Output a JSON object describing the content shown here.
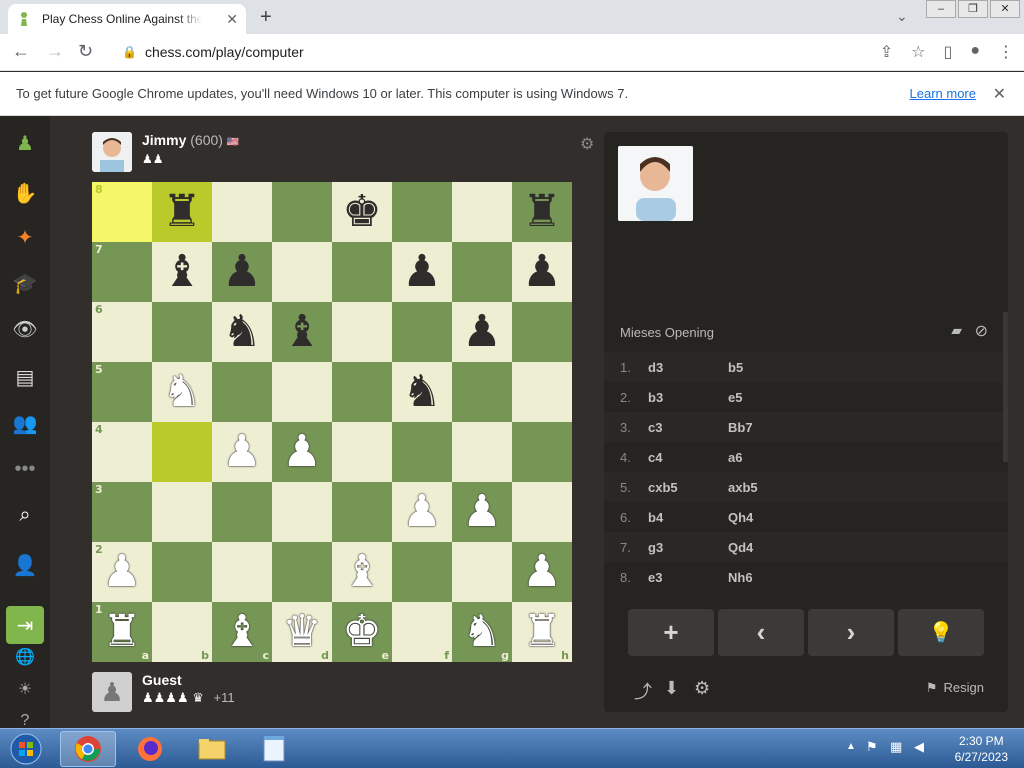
{
  "browser": {
    "tab_title": "Play Chess Online Against the Computer",
    "url": "chess.com/play/computer",
    "infobar_text": "To get future Google Chrome updates, you'll need Windows 10 or later. This computer is using Windows 7.",
    "infobar_link": "Learn more"
  },
  "top_player": {
    "name": "Jimmy",
    "rating": "(600)",
    "flag": "🇺🇸"
  },
  "bottom_player": {
    "name": "Guest",
    "captured": "♟♟♟♟ ♛",
    "material": "+11"
  },
  "board": {
    "ranks": [
      "8",
      "7",
      "6",
      "5",
      "4",
      "3",
      "2",
      "1"
    ],
    "files": [
      "a",
      "b",
      "c",
      "d",
      "e",
      "f",
      "g",
      "h"
    ],
    "rows": [
      [
        "",
        "bR",
        "",
        "",
        "bK",
        "",
        "",
        "bR"
      ],
      [
        "",
        "bB",
        "bP",
        "",
        "",
        "bP",
        "",
        "bP"
      ],
      [
        "",
        "",
        "bN",
        "bB",
        "",
        "",
        "bP",
        ""
      ],
      [
        "",
        "wN",
        "",
        "",
        "",
        "bN",
        "",
        ""
      ],
      [
        "",
        "",
        "wP",
        "wP",
        "",
        "",
        "",
        ""
      ],
      [
        "",
        "",
        "",
        "",
        "",
        "wP",
        "wP",
        ""
      ],
      [
        "wP",
        "",
        "",
        "",
        "wB",
        "",
        "",
        "wP"
      ],
      [
        "wR",
        "",
        "wB",
        "wQ",
        "wK",
        "",
        "wN",
        "wR"
      ]
    ],
    "highlighted": [
      "a8",
      "b8",
      "b4"
    ]
  },
  "opening": "Mieses Opening",
  "moves": [
    {
      "n": "1.",
      "w": "d3",
      "b": "b5"
    },
    {
      "n": "2.",
      "w": "b3",
      "b": "e5"
    },
    {
      "n": "3.",
      "w": "c3",
      "b": "Bb7"
    },
    {
      "n": "4.",
      "w": "c4",
      "b": "a6"
    },
    {
      "n": "5.",
      "w": "cxb5",
      "b": "axb5"
    },
    {
      "n": "6.",
      "w": "b4",
      "b": "Qh4"
    },
    {
      "n": "7.",
      "w": "g3",
      "b": "Qd4"
    },
    {
      "n": "8.",
      "w": "e3",
      "b": "Nh6"
    }
  ],
  "controls": {
    "new": "+",
    "prev": "‹",
    "next": "›",
    "hint": "💡",
    "resign": "Resign"
  },
  "clock": {
    "time": "2:30 PM",
    "date": "6/27/2023"
  }
}
